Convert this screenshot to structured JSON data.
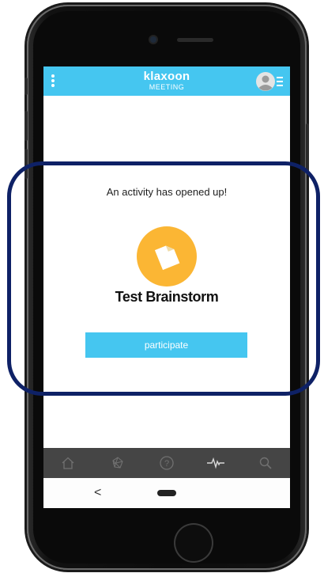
{
  "header": {
    "brand_name": "klaxoon",
    "brand_sub": "MEETING"
  },
  "main": {
    "headline": "An activity has opened up!",
    "activity_title": "Test Brainstorm",
    "participate_label": "participate"
  },
  "bottom_nav": {
    "items": [
      "home-icon",
      "brainstorm-icon",
      "question-icon",
      "pulse-icon",
      "search-icon"
    ]
  },
  "system_nav": {
    "back_label": "<"
  },
  "colors": {
    "accent": "#45c6f0",
    "activity_icon": "#fbb634",
    "nav_bar": "#454545",
    "highlight_border": "#0e2166"
  }
}
